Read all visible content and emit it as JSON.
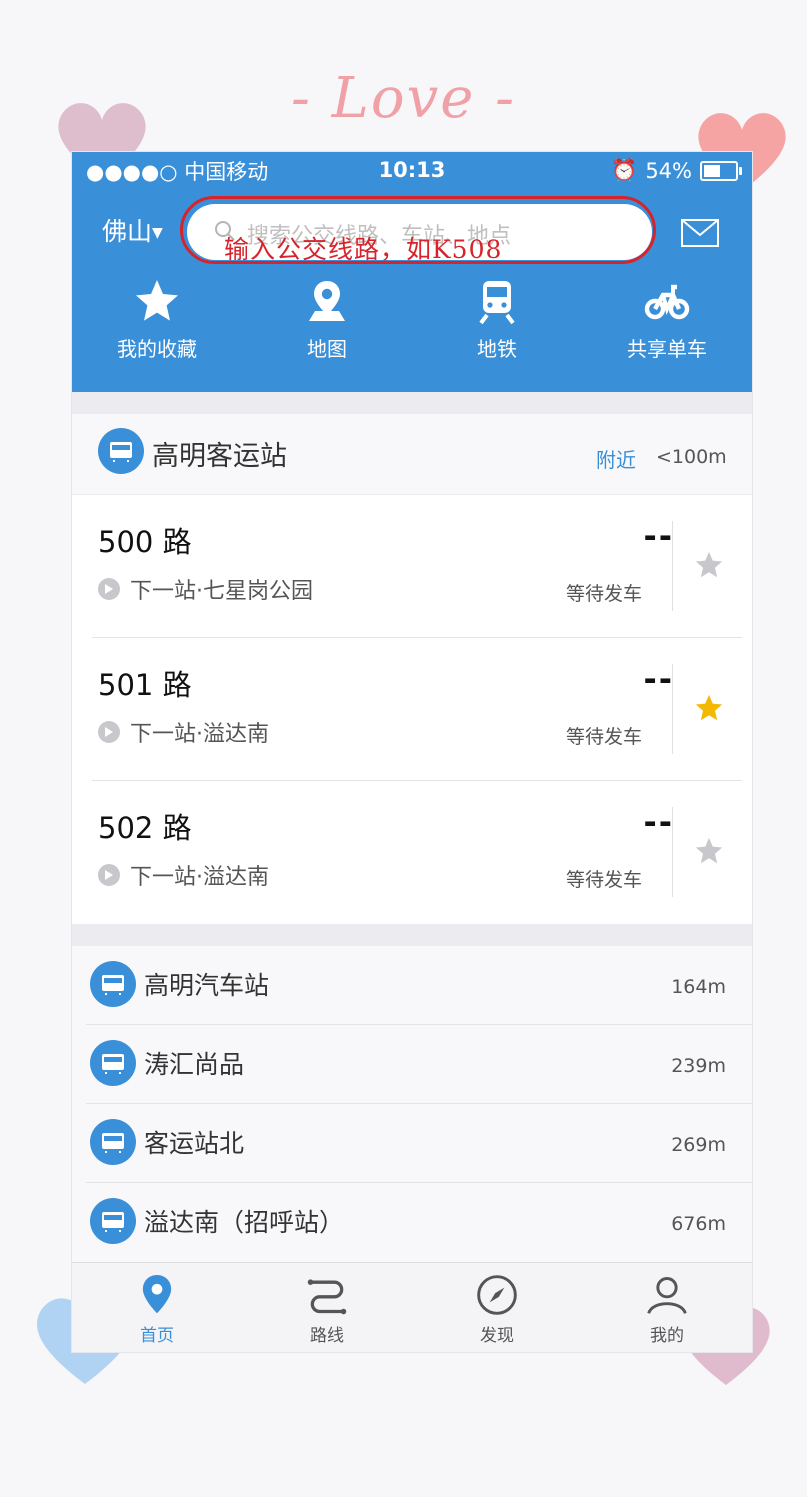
{
  "decor": {
    "love_text": "- Love -"
  },
  "status_bar": {
    "carrier": "●●●●○ 中国移动",
    "time": "10:13",
    "battery": "54%",
    "battery_level": 0.54
  },
  "header": {
    "city": "佛山",
    "search_placeholder": "搜索公交线路、车站、地点",
    "annotation": "输入公交线路，如K508"
  },
  "nav": [
    {
      "label": "我的收藏",
      "icon": "star-icon"
    },
    {
      "label": "地图",
      "icon": "map-pin-icon"
    },
    {
      "label": "地铁",
      "icon": "subway-icon"
    },
    {
      "label": "共享单车",
      "icon": "bicycle-icon"
    }
  ],
  "station": {
    "name": "高明客运站",
    "nearby_label": "附近",
    "distance": "<100m"
  },
  "routes": [
    {
      "name": "500 路",
      "next_stop": "下一站·七星岗公园",
      "eta": "--",
      "status": "等待发车",
      "favorited": false
    },
    {
      "name": "501 路",
      "next_stop": "下一站·溢达南",
      "eta": "--",
      "status": "等待发车",
      "favorited": true
    },
    {
      "name": "502 路",
      "next_stop": "下一站·溢达南",
      "eta": "--",
      "status": "等待发车",
      "favorited": false
    }
  ],
  "stops": [
    {
      "name": "高明汽车站",
      "distance": "164m"
    },
    {
      "name": "涛汇尚品",
      "distance": "239m"
    },
    {
      "name": "客运站北",
      "distance": "269m"
    },
    {
      "name": "溢达南（招呼站）",
      "distance": "676m"
    }
  ],
  "tabs": [
    {
      "label": "首页",
      "icon": "home-pin-icon",
      "active": true
    },
    {
      "label": "路线",
      "icon": "route-icon",
      "active": false
    },
    {
      "label": "发现",
      "icon": "compass-icon",
      "active": false
    },
    {
      "label": "我的",
      "icon": "profile-icon",
      "active": false
    }
  ],
  "colors": {
    "primary": "#3a8fd9",
    "annotation": "#d8232a",
    "star_active": "#f5b800",
    "star_inactive": "#c8c8cc"
  }
}
